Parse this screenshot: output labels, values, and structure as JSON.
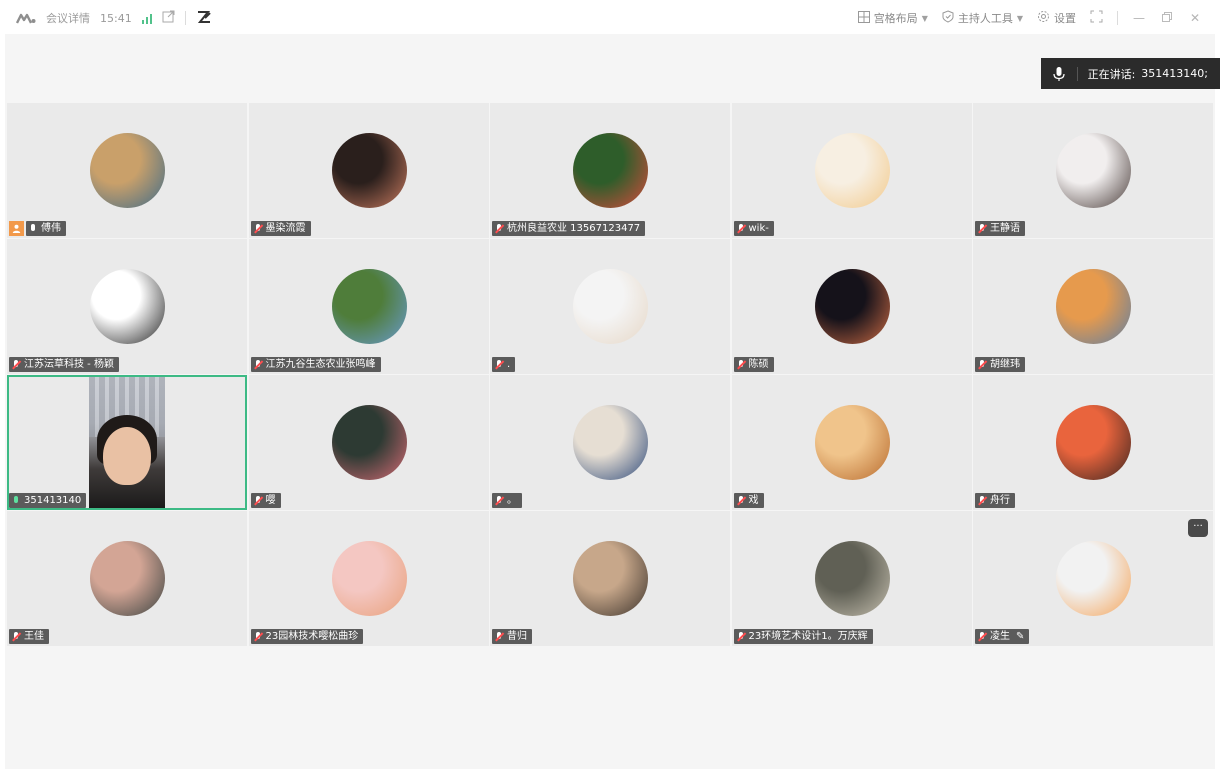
{
  "titlebar": {
    "meeting_details": "会议详情",
    "time": "15:41",
    "layout_label": "宫格布局",
    "host_tools_label": "主持人工具",
    "settings_label": "设置"
  },
  "speaking": {
    "label": "正在讲话:",
    "speaker": "351413140;"
  },
  "participants": [
    {
      "name": "傅伟",
      "host": true,
      "muted": false,
      "avatar_colors": [
        "#c9a06a",
        "#3f6b89"
      ]
    },
    {
      "name": "墨染流霞",
      "muted": true,
      "avatar_colors": [
        "#2a1f1c",
        "#c97b60"
      ]
    },
    {
      "name": "杭州良益农业  13567123477",
      "muted": true,
      "avatar_colors": [
        "#2e5d2a",
        "#d84c3e"
      ]
    },
    {
      "name": "wik-",
      "muted": true,
      "avatar_colors": [
        "#f7efe2",
        "#f2c98a"
      ]
    },
    {
      "name": "王静语",
      "muted": true,
      "avatar_colors": [
        "#f1eeee",
        "#4a3d3a"
      ]
    },
    {
      "name": "江苏沄草科技 - 杨颖",
      "muted": true,
      "avatar_colors": [
        "#ffffff",
        "#222222"
      ]
    },
    {
      "name": "江苏九谷生态农业张鸣峰",
      "muted": true,
      "avatar_colors": [
        "#4f7d3a",
        "#6a9bd0"
      ]
    },
    {
      "name": ".",
      "muted": true,
      "avatar_colors": [
        "#f4f4f4",
        "#e6d7c6"
      ]
    },
    {
      "name": "陈硕",
      "muted": true,
      "avatar_colors": [
        "#15121a",
        "#cc6b44"
      ]
    },
    {
      "name": "胡继玮",
      "muted": true,
      "avatar_colors": [
        "#e69a4d",
        "#5d7fa6"
      ]
    },
    {
      "name": "351413140",
      "muted": false,
      "active": true,
      "video": true
    },
    {
      "name": "嘤",
      "muted": true,
      "avatar_colors": [
        "#2d3a33",
        "#d66b75"
      ]
    },
    {
      "name": "。",
      "muted": true,
      "avatar_colors": [
        "#e6ded3",
        "#2e4a7a"
      ]
    },
    {
      "name": "戏",
      "muted": true,
      "avatar_colors": [
        "#f0c48b",
        "#b86a2c"
      ]
    },
    {
      "name": "舟行",
      "muted": true,
      "avatar_colors": [
        "#e9643d",
        "#3a2520"
      ]
    },
    {
      "name": "王佳",
      "muted": true,
      "avatar_colors": [
        "#d3a595",
        "#394240"
      ]
    },
    {
      "name": "23园林技术嘤松曲珍",
      "muted": true,
      "avatar_colors": [
        "#f4c7c2",
        "#e8a07a"
      ]
    },
    {
      "name": "昔归",
      "muted": true,
      "avatar_colors": [
        "#c7a78a",
        "#3b322b"
      ]
    },
    {
      "name": "23环境艺术设计1。万庆辉",
      "muted": true,
      "avatar_colors": [
        "#606055",
        "#c6c0b0"
      ]
    },
    {
      "name": "凌生",
      "muted": true,
      "pen": true,
      "avatar_colors": [
        "#f2f2f2",
        "#f4a45a"
      ]
    }
  ],
  "colors": {
    "accent": "#3dba85",
    "host_badge": "#f2994a",
    "muted_slash": "#ff4d4f"
  }
}
